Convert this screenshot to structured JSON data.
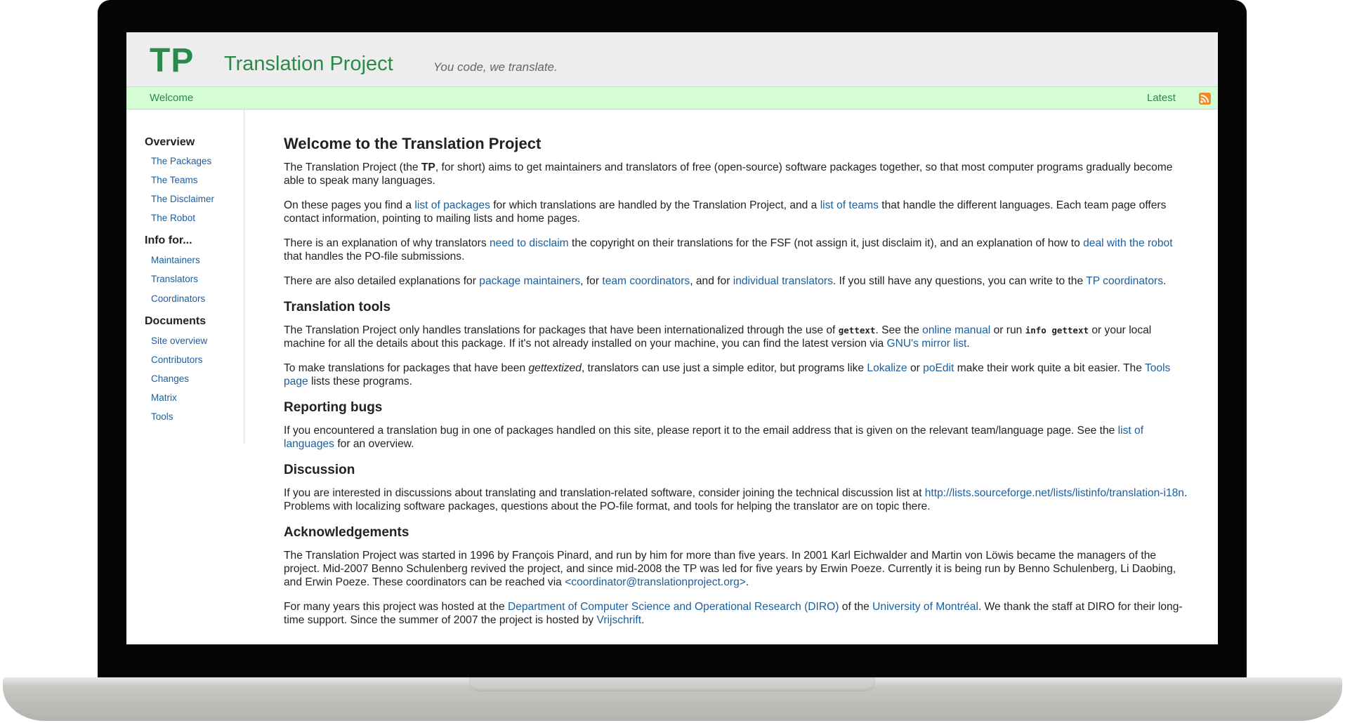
{
  "header": {
    "logo": "TP",
    "title": "Translation Project",
    "tagline": "You code, we translate."
  },
  "navbar": {
    "welcome": "Welcome",
    "latest": "Latest",
    "feed_icon": "rss-icon"
  },
  "sidebar": {
    "sections": [
      {
        "heading": "Overview",
        "items": [
          "The Packages",
          "The Teams",
          "The Disclaimer",
          "The Robot"
        ]
      },
      {
        "heading": "Info for...",
        "items": [
          "Maintainers",
          "Translators",
          "Coordinators"
        ]
      },
      {
        "heading": "Documents",
        "items": [
          "Site overview",
          "Contributors",
          "Changes",
          "Matrix",
          "Tools"
        ]
      }
    ]
  },
  "main": {
    "title": "Welcome to the Translation Project",
    "intro": {
      "a": "The Translation Project (the ",
      "b": "TP",
      "c": ", for short) aims to get maintainers and translators of free (open-source) software packages together, so that most computer programs gradually become able to speak many languages."
    },
    "pages": {
      "a": "On these pages you find a ",
      "link1": "list of packages",
      "b": " for which translations are handled by the Translation Project, and a ",
      "link2": "list of teams",
      "c": " that handle the different languages. Each team page offers contact information, pointing to mailing lists and home pages."
    },
    "disclaim": {
      "a": "There is an explanation of why translators ",
      "link1": "need to disclaim",
      "b": " the copyright on their translations for the FSF (not assign it, just disclaim it), and an explanation of how to ",
      "link2": "deal with the robot",
      "c": " that handles the PO-file submissions."
    },
    "explain": {
      "a": "There are also detailed explanations for ",
      "link1": "package maintainers",
      "b": ", for ",
      "link2": "team coordinators",
      "c": ", and for ",
      "link3": "individual translators",
      "d": ". If you still have any questions, you can write to the ",
      "link4": "TP coordinators",
      "e": "."
    },
    "tools_heading": "Translation tools",
    "tools1": {
      "a": "The Translation Project only handles translations for packages that have been internationalized through the use of ",
      "code1": "gettext",
      "b": ". See the ",
      "link1": "online manual",
      "c": " or run ",
      "code2": "info gettext",
      "d": " or your local machine for all the details about this package. If it's not already installed on your machine, you can find the latest version via ",
      "link2": "GNU's mirror list",
      "e": "."
    },
    "tools2": {
      "a": "To make translations for packages that have been ",
      "em": "gettextized",
      "b": ", translators can use just a simple editor, but programs like ",
      "link1": "Lokalize",
      "c": " or ",
      "link2": "poEdit",
      "d": " make their work quite a bit easier. The ",
      "link3": "Tools page",
      "e": " lists these programs."
    },
    "bugs_heading": "Reporting bugs",
    "bugs": {
      "a": "If you encountered a translation bug in one of packages handled on this site, please report it to the email address that is given on the relevant team/language page. See the ",
      "link1": "list of languages",
      "b": " for an overview."
    },
    "discussion_heading": "Discussion",
    "discussion": {
      "a": "If you are interested in discussions about translating and translation-related software, consider joining the technical discussion list at ",
      "link1": "http://lists.sourceforge.net/lists/listinfo/translation-i18n",
      "b": ". Problems with localizing software packages, questions about the PO-file format, and tools for helping the translator are on topic there."
    },
    "ack_heading": "Acknowledgements",
    "ack1": {
      "a": "The Translation Project was started in 1996 by François Pinard, and run by him for more than five years. In 2001 Karl Eichwalder and Martin von Löwis became the managers of the project. Mid-2007 Benno Schulenberg revived the project, and since mid-2008 the TP was led for five years by Erwin Poeze. Currently it is being run by Benno Schulenberg, Li Daobing, and Erwin Poeze. These coordinators can be reached via ",
      "link1": "<coordinator@translationproject.org>",
      "b": "."
    },
    "ack2": {
      "a": "For many years this project was hosted at the ",
      "link1": "Department of Computer Science and Operational Research (DIRO)",
      "b": " of the ",
      "link2": "University of Montréal",
      "c": ". We thank the staff at DIRO for their long-time support. Since the summer of 2007 the project is hosted by ",
      "link3": "Vrijschrift",
      "d": "."
    }
  }
}
